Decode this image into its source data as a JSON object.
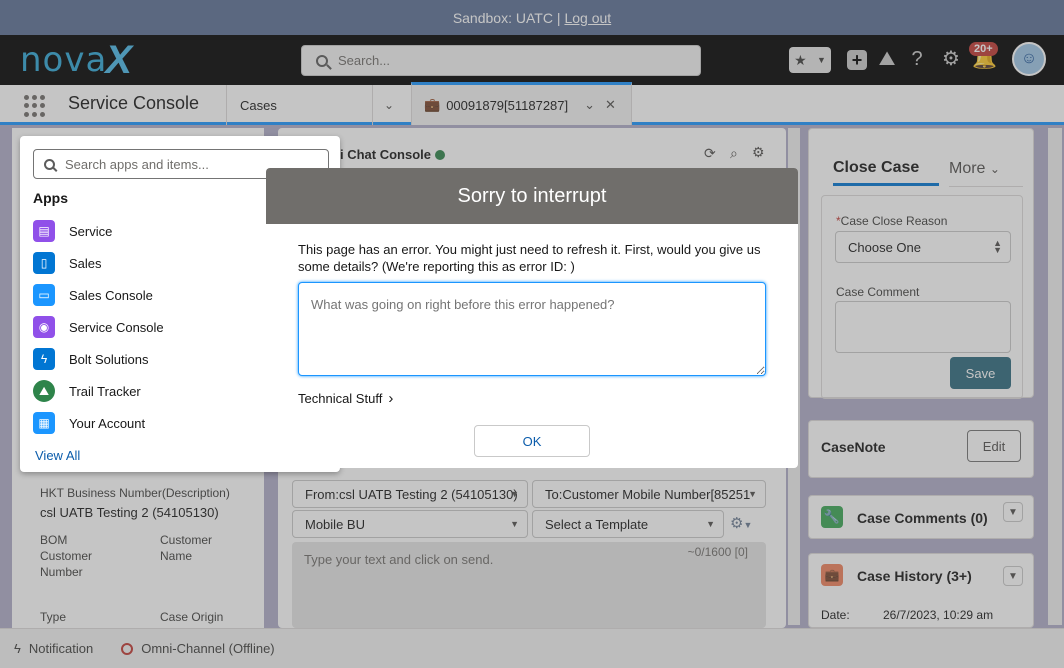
{
  "sandbox": {
    "text": "Sandbox: UATC |",
    "logout": "Log out"
  },
  "global": {
    "logo_main": "nova",
    "logo_x": "X",
    "search_placeholder": "Search...",
    "notification_count": "20+"
  },
  "nav": {
    "app_name": "Service Console",
    "object_tab": "Cases",
    "record_tab": "00091879[51187287]"
  },
  "launcher": {
    "search_placeholder": "Search apps and items...",
    "heading": "Apps",
    "apps": [
      {
        "label": "Service",
        "color": "#9050e9"
      },
      {
        "label": "Sales",
        "color": "#0176d3"
      },
      {
        "label": "Sales Console",
        "color": "#1b96ff"
      },
      {
        "label": "Service Console",
        "color": "#9050e9"
      },
      {
        "label": "Bolt Solutions",
        "color": "#0176d3"
      },
      {
        "label": "Trail Tracker",
        "color": "#2e844a"
      },
      {
        "label": "Your Account",
        "color": "#1b96ff"
      }
    ],
    "view_all": "View All"
  },
  "left_panel": {
    "business_number_label": "HKT Business Number(Description)",
    "business_number_value": "csl UATB Testing 2 (54105130)",
    "bom_label": "BOM Customer Number",
    "customer_name_label": "Customer Name",
    "type_label": "Type",
    "case_origin_label": "Case Origin"
  },
  "chat": {
    "title": "i Chat Console",
    "from": "From:csl UATB Testing 2 (54105130)",
    "to": "To:Customer Mobile Number[85251",
    "bu": "Mobile BU",
    "template": "Select a Template",
    "message_placeholder": "Type your text and click on send.",
    "counter": "~0/1600 [0]"
  },
  "modal": {
    "title": "Sorry to interrupt",
    "message": "This page has an error. You might just need to refresh it. First, would you give us some details? (We're reporting this as error ID: )",
    "textarea_placeholder": "What was going on right before this error happened?",
    "technical": "Technical Stuff",
    "ok": "OK"
  },
  "right_panel": {
    "close_case_tab": "Close Case",
    "more_tab": "More",
    "close_reason_label": "Case Close Reason",
    "close_reason_value": "Choose One",
    "comment_label": "Case Comment",
    "save": "Save",
    "casenote_title": "CaseNote",
    "edit": "Edit",
    "case_comments": "Case Comments (0)",
    "case_history": "Case History (3+)",
    "date_label": "Date:",
    "date_value": "26/7/2023, 10:29 am"
  },
  "utility": {
    "notification": "Notification",
    "omni": "Omni-Channel (Offline)"
  }
}
